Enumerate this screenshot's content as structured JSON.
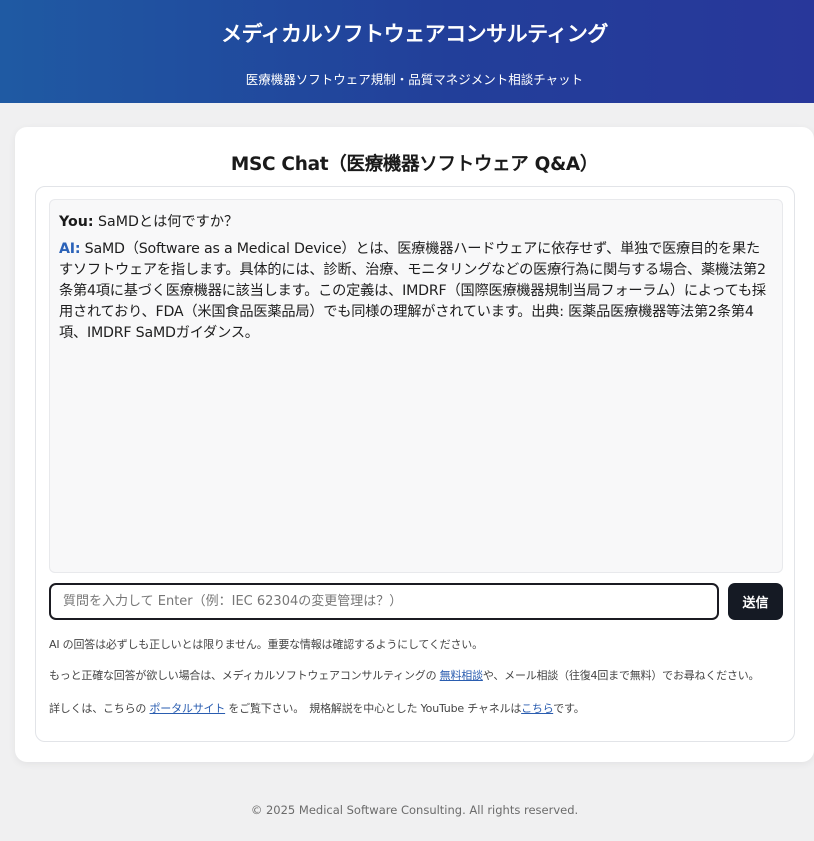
{
  "header": {
    "title": "メディカルソフトウェアコンサルティング",
    "subtitle": "医療機器ソフトウェア規制・品質マネジメント相談チャット"
  },
  "chat": {
    "title": "MSC Chat（医療機器ソフトウェア Q&A）",
    "messages": [
      {
        "speaker": "You:",
        "text": "SaMDとは何ですか？"
      },
      {
        "speaker": "AI:",
        "text": "SaMD（Software as a Medical Device）とは、医療機器ハードウェアに依存せず、単独で医療目的を果たすソフトウェアを指します。具体的には、診断、治療、モニタリングなどの医療行為に関与する場合、薬機法第2条第4項に基づく医療機器に該当します。この定義は、IMDRF（国際医療機器規制当局フォーラム）によっても採用されており、FDA（米国食品医薬品局）でも同様の理解がされています。出典: 医薬品医療機器等法第2条第4項、IMDRF SaMDガイダンス。"
      }
    ],
    "input": {
      "placeholder": "質問を入力して Enter（例：IEC 62304の変更管理は？）",
      "value": ""
    },
    "send_label": "送信"
  },
  "notes": {
    "disclaimer": "AI の回答は必ずしも正しいとは限りません。重要な情報は確認するようにしてください。",
    "consult_prefix": "もっと正確な回答が欲しい場合は、メディカルソフトウェアコンサルティングの ",
    "consult_link": "無料相談",
    "consult_suffix": "や、メール相談（往復4回まで無料）でお尋ねください。",
    "portal_prefix": "詳しくは、こちらの ",
    "portal_link": "ポータルサイト",
    "portal_middle": " をご覧下さい。　規格解説を中心とした YouTube チャネルは",
    "youtube_link": "こちら",
    "portal_suffix": "です。"
  },
  "footer": {
    "copyright": "© 2025 Medical Software Consulting. All rights reserved."
  },
  "colors": {
    "header_start": "#1f5aa3",
    "header_end": "#28379a",
    "ai_label": "#2b62b8",
    "send_button": "#151a24",
    "link": "#2a5db0"
  }
}
